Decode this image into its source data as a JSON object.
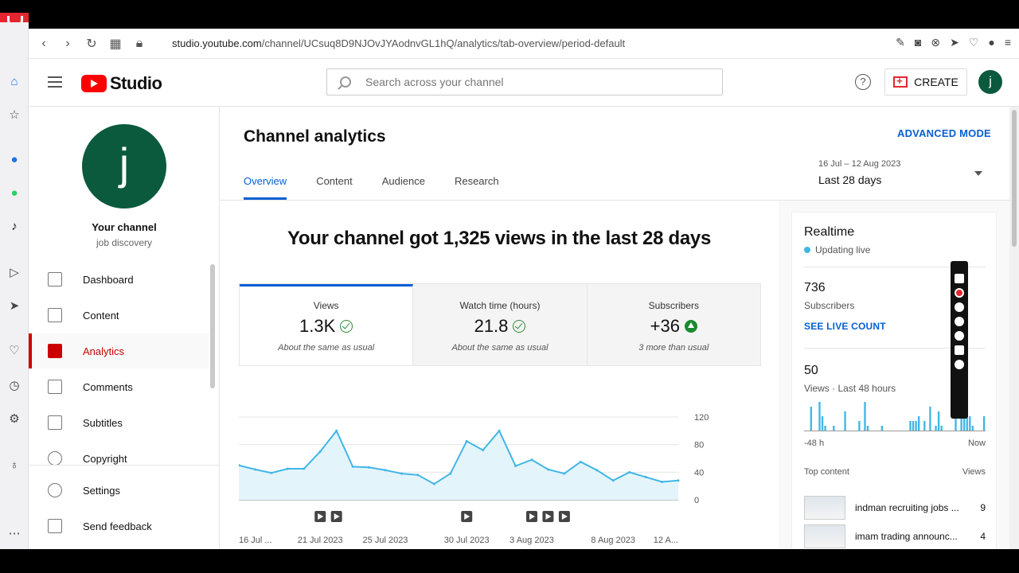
{
  "browser": {
    "url_host": "studio.youtube.com",
    "url_path": "/channel/UCsuq8D9NJOvJYAodnvGL1hQ/analytics/tab-overview/period-default"
  },
  "header": {
    "logo_text": "Studio",
    "search_placeholder": "Search across your channel",
    "help_label": "?",
    "create_label": "CREATE",
    "avatar_letter": "j"
  },
  "sidebar": {
    "avatar_letter": "j",
    "channel_title": "Your channel",
    "channel_name": "job discovery",
    "items": [
      {
        "label": "Dashboard"
      },
      {
        "label": "Content"
      },
      {
        "label": "Analytics"
      },
      {
        "label": "Comments"
      },
      {
        "label": "Subtitles"
      },
      {
        "label": "Copyright"
      },
      {
        "label": "Settings"
      },
      {
        "label": "Send feedback"
      }
    ]
  },
  "main": {
    "title": "Channel analytics",
    "advanced_mode": "ADVANCED MODE",
    "tabs": [
      {
        "label": "Overview"
      },
      {
        "label": "Content"
      },
      {
        "label": "Audience"
      },
      {
        "label": "Research"
      }
    ],
    "date_range": "16 Jul – 12 Aug 2023",
    "period": "Last 28 days",
    "headline": "Your channel got 1,325 views in the last 28 days",
    "cards": [
      {
        "label": "Views",
        "value": "1.3K",
        "note": "About the same as usual"
      },
      {
        "label": "Watch time (hours)",
        "value": "21.8",
        "note": "About the same as usual"
      },
      {
        "label": "Subscribers",
        "value": "+36",
        "note": "3 more than usual"
      }
    ]
  },
  "chart_data": {
    "type": "area",
    "x": [
      "16 Jul",
      "17 Jul",
      "18 Jul",
      "19 Jul",
      "20 Jul",
      "21 Jul",
      "22 Jul",
      "23 Jul",
      "24 Jul",
      "25 Jul",
      "26 Jul",
      "27 Jul",
      "28 Jul",
      "29 Jul",
      "30 Jul",
      "31 Jul",
      "1 Aug",
      "2 Aug",
      "3 Aug",
      "4 Aug",
      "5 Aug",
      "6 Aug",
      "7 Aug",
      "8 Aug",
      "9 Aug",
      "10 Aug",
      "11 Aug",
      "12 Aug"
    ],
    "values": [
      50,
      44,
      39,
      45,
      45,
      70,
      100,
      48,
      47,
      43,
      38,
      36,
      23,
      38,
      85,
      72,
      100,
      49,
      58,
      44,
      38,
      55,
      43,
      28,
      40,
      33,
      26,
      28
    ],
    "ylim": [
      0,
      120
    ],
    "yticks": [
      0,
      40,
      80,
      120
    ],
    "xtick_labels": [
      "16 Jul ...",
      "21 Jul 2023",
      "25 Jul 2023",
      "30 Jul 2023",
      "3 Aug 2023",
      "8 Aug 2023",
      "12 A..."
    ],
    "xtick_index": [
      0,
      5,
      9,
      14,
      18,
      23,
      27
    ],
    "video_markers": [
      5,
      6,
      14,
      18,
      19,
      20
    ],
    "grid": true,
    "color": "#41b6e6",
    "fill": "#e4f4fb"
  },
  "realtime": {
    "title": "Realtime",
    "status": "Updating live",
    "subscribers_value": "736",
    "subscribers_label": "Subscribers",
    "live_count": "SEE LIVE COUNT",
    "views_value": "50",
    "views_label": "Views · Last 48 hours",
    "axis_start": "-48 h",
    "axis_end": "Now",
    "spark_values": [
      0,
      0,
      5,
      0,
      0,
      6,
      3,
      1,
      0,
      0,
      1,
      0,
      0,
      0,
      4,
      0,
      0,
      0,
      0,
      2,
      0,
      6,
      1,
      0,
      0,
      0,
      0,
      1,
      0,
      0,
      0,
      0,
      0,
      0,
      0,
      0,
      0,
      2,
      2,
      2,
      3,
      0,
      2,
      0,
      5,
      0,
      1,
      4,
      1,
      0,
      0,
      0,
      0,
      5,
      0,
      3,
      4,
      3,
      3,
      1,
      0,
      0,
      0,
      3
    ],
    "top_content_label": "Top content",
    "views_col_label": "Views",
    "top_content": [
      {
        "title": "indman recruiting jobs ...",
        "views": "9"
      },
      {
        "title": "imam trading announc...",
        "views": "4"
      }
    ]
  }
}
